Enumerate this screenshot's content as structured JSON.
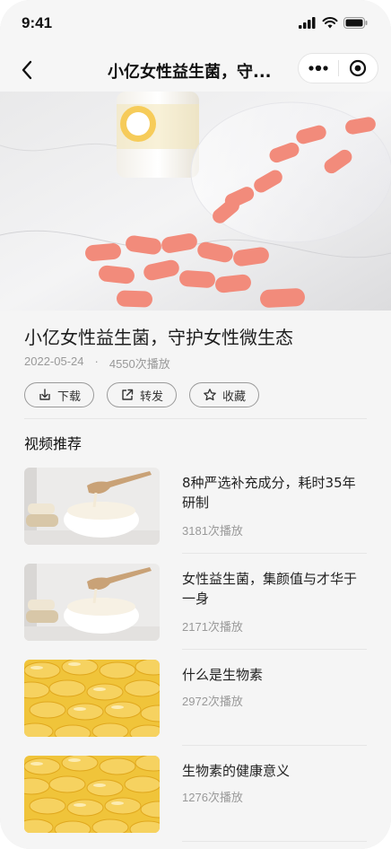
{
  "status_bar": {
    "time": "9:41"
  },
  "nav": {
    "title": "小亿女性益生菌，守..."
  },
  "video": {
    "title": "小亿女性益生菌，守护女性微生态",
    "date": "2022-05-24",
    "dot": "·",
    "plays": "4550次播放",
    "actions": {
      "download": "下载",
      "share": "转发",
      "favorite": "收藏"
    }
  },
  "recommend": {
    "heading": "视频推荐",
    "items": [
      {
        "title": "8种严选补充成分，耗时35年研制",
        "plays": "3181次播放",
        "thumb": "milk"
      },
      {
        "title": "女性益生菌，集颜值与才华于一身",
        "plays": "2171次播放",
        "thumb": "milk"
      },
      {
        "title": "什么是生物素",
        "plays": "2972次播放",
        "thumb": "capsules"
      },
      {
        "title": "生物素的健康意义",
        "plays": "1276次播放",
        "thumb": "capsules"
      }
    ]
  }
}
